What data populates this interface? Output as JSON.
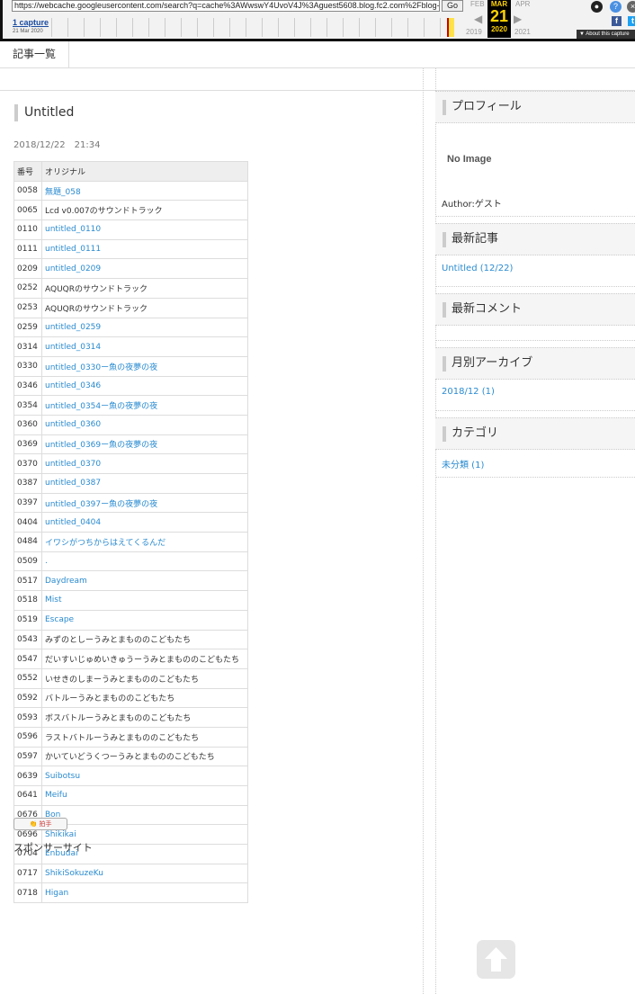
{
  "wayback": {
    "url": "https://webcache.googleusercontent.com/search?q=cache%3AWwswY4UvoV4J%3Aguest5608.blog.fc2.com%2Fblog-e",
    "go_label": "Go",
    "capture_link": "1 capture",
    "capture_date": "21 Mar 2020",
    "prev_month": "FEB",
    "cur_month": "MAR",
    "next_month": "APR",
    "day": "21",
    "prev_year": "2019",
    "cur_year": "2020",
    "next_year": "2021",
    "about_label": "▼ About this capture"
  },
  "nav": {
    "article_list": "記事一覧"
  },
  "post": {
    "title": "Untitled",
    "date": "2018/12/22　21:34",
    "table_headers": [
      "番号",
      "オリジナル"
    ],
    "rows": [
      {
        "num": "0058",
        "title": "無題_058",
        "link": true
      },
      {
        "num": "0065",
        "title": "Lcd v0.007のサウンドトラック",
        "link": false
      },
      {
        "num": "0110",
        "title": "untitled_0110",
        "link": true
      },
      {
        "num": "0111",
        "title": "untitled_0111",
        "link": true
      },
      {
        "num": "0209",
        "title": "untitled_0209",
        "link": true
      },
      {
        "num": "0252",
        "title": "AQUQRのサウンドトラック",
        "link": false
      },
      {
        "num": "0253",
        "title": "AQUQRのサウンドトラック",
        "link": false
      },
      {
        "num": "0259",
        "title": "untitled_0259",
        "link": true
      },
      {
        "num": "0314",
        "title": "untitled_0314",
        "link": true
      },
      {
        "num": "0330",
        "title": "untitled_0330ー魚の夜夢の夜",
        "link": true
      },
      {
        "num": "0346",
        "title": "untitled_0346",
        "link": true
      },
      {
        "num": "0354",
        "title": "untitled_0354ー魚の夜夢の夜",
        "link": true
      },
      {
        "num": "0360",
        "title": "untitled_0360",
        "link": true
      },
      {
        "num": "0369",
        "title": "untitled_0369ー魚の夜夢の夜",
        "link": true
      },
      {
        "num": "0370",
        "title": "untitled_0370",
        "link": true
      },
      {
        "num": "0387",
        "title": "untitled_0387",
        "link": true
      },
      {
        "num": "0397",
        "title": "untitled_0397ー魚の夜夢の夜",
        "link": true
      },
      {
        "num": "0404",
        "title": "untitled_0404",
        "link": true
      },
      {
        "num": "0484",
        "title": "イワシがつちからはえてくるんだ",
        "link": true
      },
      {
        "num": "0509",
        "title": ".",
        "link": true
      },
      {
        "num": "0517",
        "title": "Daydream",
        "link": true
      },
      {
        "num": "0518",
        "title": "Mist",
        "link": true
      },
      {
        "num": "0519",
        "title": "Escape",
        "link": true
      },
      {
        "num": "0543",
        "title": "みずのとしーうみとまもののこどもたち",
        "link": false
      },
      {
        "num": "0547",
        "title": "だいすいじゅめいきゅうーうみとまもののこどもたち",
        "link": false
      },
      {
        "num": "0552",
        "title": "いせきのしまーうみとまもののこどもたち",
        "link": false
      },
      {
        "num": "0592",
        "title": "バトルーうみとまもののこどもたち",
        "link": false
      },
      {
        "num": "0593",
        "title": "ボスバトルーうみとまもののこどもたち",
        "link": false
      },
      {
        "num": "0596",
        "title": "ラストバトルーうみとまもののこどもたち",
        "link": false
      },
      {
        "num": "0597",
        "title": "かいていどうくつーうみとまもののこどもたち",
        "link": false
      },
      {
        "num": "0639",
        "title": "Suibotsu",
        "link": true
      },
      {
        "num": "0641",
        "title": "Meifu",
        "link": true
      },
      {
        "num": "0676",
        "title": "Bon",
        "link": true
      },
      {
        "num": "0696",
        "title": "Shikikai",
        "link": true
      },
      {
        "num": "0704",
        "title": "Enbudai",
        "link": true
      },
      {
        "num": "0717",
        "title": "ShikiSokuzeKu",
        "link": true
      },
      {
        "num": "0718",
        "title": "Higan",
        "link": true
      }
    ],
    "clap_label": "拍手",
    "sponsor_label": "スポンサーサイト"
  },
  "sidebar": {
    "profile_title": "プロフィール",
    "no_image": "No Image",
    "author": "Author:ゲスト",
    "recent_title": "最新記事",
    "recent_item": "Untitled (12/22)",
    "comments_title": "最新コメント",
    "archive_title": "月別アーカイブ",
    "archive_item": "2018/12 (1)",
    "category_title": "カテゴリ",
    "category_item": "未分類 (1)"
  },
  "colors": {
    "link": "#2a8bd0",
    "wayback_day": "#ffd200"
  },
  "icons": [
    "left-arrow-icon",
    "right-arrow-icon",
    "user-icon",
    "help-icon",
    "close-icon",
    "facebook-icon",
    "twitter-icon",
    "clap-icon",
    "up-arrow-icon"
  ]
}
